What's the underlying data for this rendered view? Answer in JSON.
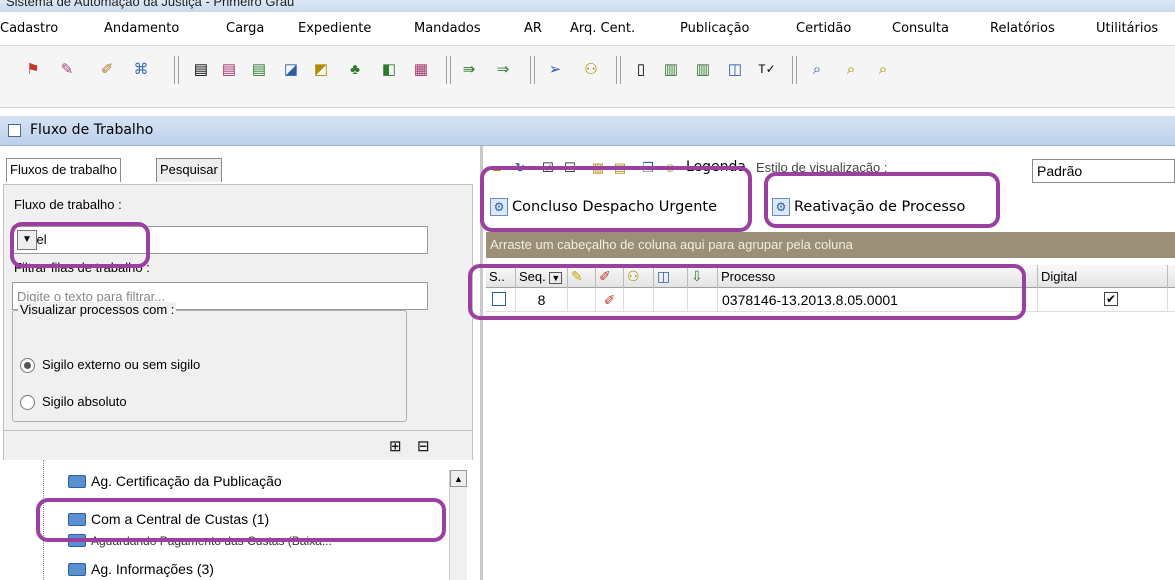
{
  "window": {
    "title": "Sistema de Automação da Justiça - Primeiro Grau"
  },
  "menu": [
    "Cadastro",
    "Andamento",
    "Carga",
    "Expediente",
    "Mandados",
    "AR",
    "Arq. Cent.",
    "Publicação",
    "Certidão",
    "Consulta",
    "Relatórios",
    "Utilitários"
  ],
  "panel": {
    "title": "Fluxo de Trabalho"
  },
  "left": {
    "tabs": [
      "Fluxos de trabalho",
      "Pesquisar"
    ],
    "fluxo_label": "Fluxo de trabalho :",
    "fluxo_value": "Cível",
    "filtrar_label": "Filtrar filas de trabalho :",
    "filtrar_placeholder": "Digite o texto para filtrar...",
    "visualizar_label": "Visualizar processos com :",
    "options": [
      "Sigilo externo ou sem sigilo",
      "Sigilo absoluto"
    ],
    "selected_option": 0,
    "tree": [
      "Ag. Certificação da Publicação",
      "Com a Central de Custas (1)",
      "Aguardando Pagamento das Custas (Baixa...",
      "Ag. Informações (3)"
    ]
  },
  "right": {
    "toolbar": {
      "legenda": "Legenda",
      "estilo_label": "Estilo de visualização :",
      "estilo_value": "Padrão"
    },
    "actions": [
      "Concluso Despacho Urgente",
      "Reativação de Processo"
    ],
    "group_hint": "Arraste um cabeçalho de coluna aqui para agrupar pela coluna",
    "columns": {
      "s": "S..",
      "seq": "Seq.",
      "processo": "Processo",
      "digital": "Digital"
    },
    "rows": [
      {
        "seq": "8",
        "processo": "0378146-13.2013.8.05.0001",
        "digital": true,
        "selected": false
      }
    ]
  },
  "colors": {
    "highlight": "#9b3fa0",
    "group_bar": "#9b8f78",
    "panel_header": "#bcd0ea"
  }
}
